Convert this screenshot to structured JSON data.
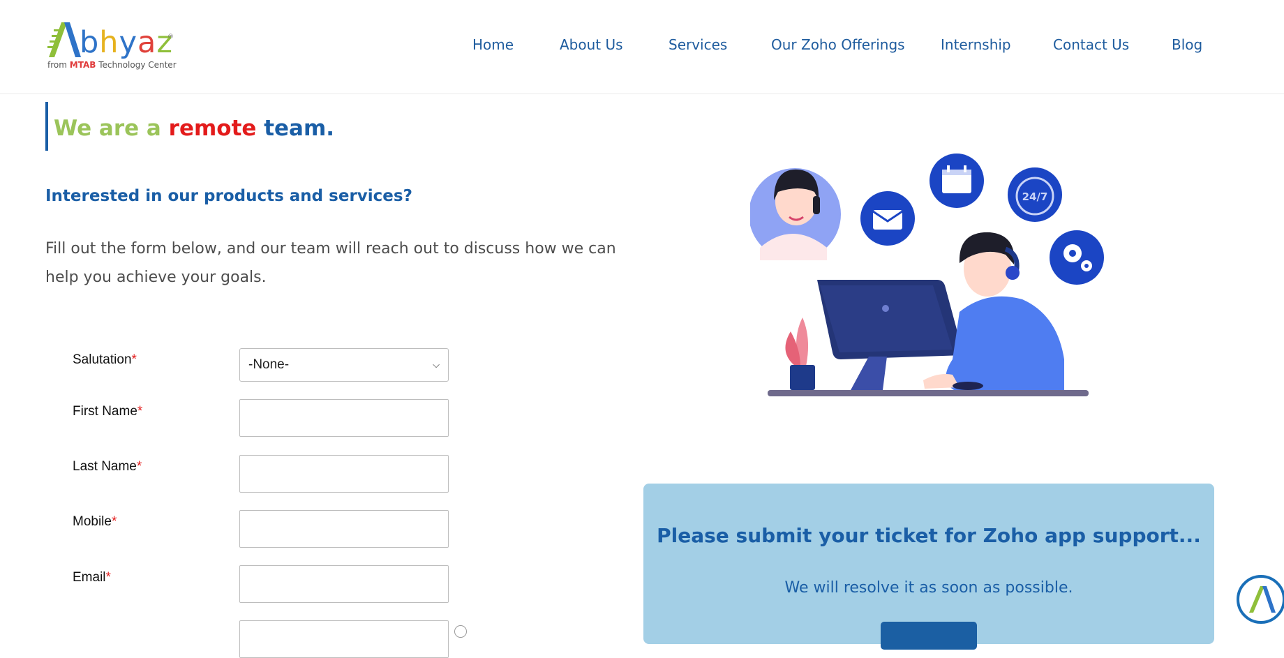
{
  "brand": {
    "logo_word": [
      "b",
      "h",
      "y",
      "a",
      "z"
    ],
    "logo_reg": "®",
    "logo_sub_prefix": "from ",
    "logo_sub_mtab": "MTAB",
    "logo_sub_suffix": " Technology Center"
  },
  "nav": {
    "items": [
      {
        "label": "Home"
      },
      {
        "label": "About Us"
      },
      {
        "label": "Services"
      },
      {
        "label": "Our Zoho Offerings"
      },
      {
        "label": "Internship"
      },
      {
        "label": "Contact Us"
      },
      {
        "label": "Blog"
      }
    ]
  },
  "hero": {
    "headline_part1": "We are a ",
    "headline_part2": "remote",
    "headline_part3": " team.",
    "subhead": "Interested in our products and services?",
    "intro": "Fill out the form below, and our team will reach out to discuss how we can help you achieve your goals."
  },
  "form": {
    "required_mark": "*",
    "fields": [
      {
        "label": "Salutation",
        "type": "select",
        "value": "-None-"
      },
      {
        "label": "First Name",
        "type": "text",
        "value": ""
      },
      {
        "label": "Last Name",
        "type": "text",
        "value": ""
      },
      {
        "label": "Mobile",
        "type": "text",
        "value": ""
      },
      {
        "label": "Email",
        "type": "text",
        "value": ""
      }
    ]
  },
  "illustration": {
    "badge_text": "24/7"
  },
  "support": {
    "title": "Please submit your ticket for Zoho app support...",
    "text": "We will resolve it as soon as possible."
  },
  "colors": {
    "primary": "#1a5ea6",
    "accent_green": "#9bc45a",
    "accent_red": "#e31b1b",
    "support_bg": "#a3cfe6"
  }
}
